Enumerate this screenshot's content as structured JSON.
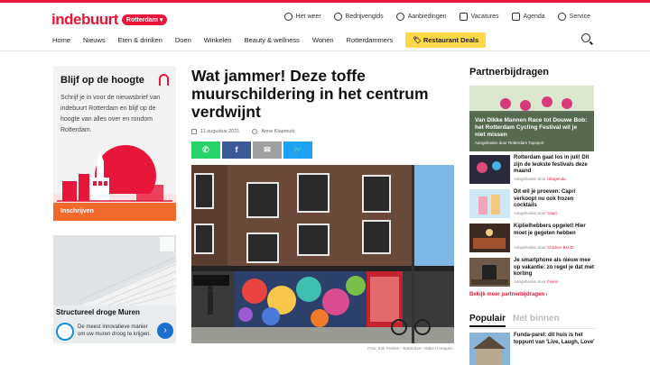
{
  "header": {
    "logo": "indebuurt",
    "city": "Rotterdam",
    "utility": [
      {
        "label": "Het weer",
        "icon": "weather-icon"
      },
      {
        "label": "Bedrijvengids",
        "icon": "location-pin-icon"
      },
      {
        "label": "Aanbiedingen",
        "icon": "tag-icon"
      },
      {
        "label": "Vacatures",
        "icon": "briefcase-icon"
      },
      {
        "label": "Agenda",
        "icon": "calendar-icon"
      },
      {
        "label": "Service",
        "icon": "gear-icon"
      }
    ],
    "nav": [
      "Home",
      "Nieuws",
      "Eten & drinken",
      "Doen",
      "Winkelen",
      "Beauty & wellness",
      "Wonen",
      "Rotterdammers"
    ],
    "deals_label": "Restaurant Deals"
  },
  "subscribe": {
    "title": "Blijf op de hoogte",
    "text": "Schrijf je in voor de nieuwsbrief van indebuurt Rotterdam en blijf op de hoogte van alles over en rondom Rotterdam.",
    "button": "Inschrijven"
  },
  "ad": {
    "title": "Structureel droge Muren",
    "text": "De meest innovatieve manier om uw muren droog te krijgen."
  },
  "article": {
    "title": "Wat jammer! Deze toffe muurschildering in het centrum verdwijnt",
    "date": "11 augustus 2021",
    "author": "Anne Klapmuts",
    "caption": "Foto: Erik Fecken - Rotterdam: Make It Happen."
  },
  "partner": {
    "heading": "Partnerbijdragen",
    "hero_title": "Van Dikke Mannen Race tot Douwe Bob: het Rotterdam Cycling Festival wil je niet missen",
    "hero_sub": "Aangeboden door Rotterdam Topsport",
    "items": [
      {
        "title": "Rotterdam gaat los in juli! Dit zijn de leukste festivals deze maand",
        "sponsor_prefix": "Aangeboden door",
        "sponsor": "Uitagenda"
      },
      {
        "title": "Dit wil je proeven: Capri verkoopt nu ook frozen cocktails",
        "sponsor_prefix": "Aangeboden door",
        "sponsor": "Capri"
      },
      {
        "title": "Kiplielhebbers opgelet! Hier moet je gegeten hebben",
        "sponsor_prefix": "Aangeboden door",
        "sponsor": "Chicken BLVD"
      },
      {
        "title": "Je smartphone als nieuw mee op vakantie: zo regel je dat met korting",
        "sponsor_prefix": "Aangeboden door",
        "sponsor": "Fixers"
      }
    ],
    "more": "Bekijk meer partnerbijdragen ›"
  },
  "tabs": {
    "popular": "Populair",
    "new": "Net binnen"
  },
  "popular_item": "Funda-parel: dit huis is het toppunt van 'Live, Laugh, Love'",
  "colors": {
    "brand": "#e8173a",
    "whatsapp": "#25d366",
    "facebook": "#3b5998",
    "mail": "#a0a0a0",
    "twitter": "#1da1f2",
    "deals": "#ffd84a",
    "subscribe_button": "#f06a2b"
  }
}
